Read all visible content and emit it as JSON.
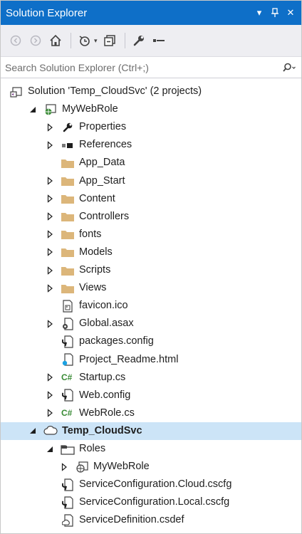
{
  "window": {
    "title": "Solution Explorer",
    "title_buttons": {
      "dropdown": "▾",
      "pin": "ᛘ",
      "close": "✕"
    }
  },
  "search": {
    "placeholder": "Search Solution Explorer (Ctrl+;)"
  },
  "toolbar": {
    "icons": [
      "back-icon",
      "forward-icon",
      "home-icon",
      "history-icon",
      "collapse-all-icon",
      "properties-wrench-icon",
      "preview-dash-icon"
    ]
  },
  "colors": {
    "title_bar": "#0e6fc8",
    "selection": "#cce4f7",
    "folder": "#dcb67a",
    "csharp": "#388a34"
  },
  "tree": [
    {
      "label": "Solution 'Temp_CloudSvc' (2 projects)",
      "icon": "solution-icon",
      "expander": "none",
      "indent": 0
    },
    {
      "label": "MyWebRole",
      "icon": "web-project-icon",
      "expander": "expanded",
      "indent": 1
    },
    {
      "label": "Properties",
      "icon": "wrench-icon",
      "expander": "collapsed",
      "indent": 2
    },
    {
      "label": "References",
      "icon": "references-icon",
      "expander": "collapsed",
      "indent": 2
    },
    {
      "label": "App_Data",
      "icon": "folder-icon",
      "expander": "none",
      "indent": 2
    },
    {
      "label": "App_Start",
      "icon": "folder-icon",
      "expander": "collapsed",
      "indent": 2
    },
    {
      "label": "Content",
      "icon": "folder-icon",
      "expander": "collapsed",
      "indent": 2
    },
    {
      "label": "Controllers",
      "icon": "folder-icon",
      "expander": "collapsed",
      "indent": 2
    },
    {
      "label": "fonts",
      "icon": "folder-icon",
      "expander": "collapsed",
      "indent": 2
    },
    {
      "label": "Models",
      "icon": "folder-icon",
      "expander": "collapsed",
      "indent": 2
    },
    {
      "label": "Scripts",
      "icon": "folder-icon",
      "expander": "collapsed",
      "indent": 2
    },
    {
      "label": "Views",
      "icon": "folder-icon",
      "expander": "collapsed",
      "indent": 2
    },
    {
      "label": "favicon.ico",
      "icon": "image-file-icon",
      "expander": "none",
      "indent": 2
    },
    {
      "label": "Global.asax",
      "icon": "asax-file-icon",
      "expander": "collapsed",
      "indent": 2
    },
    {
      "label": "packages.config",
      "icon": "config-file-icon",
      "expander": "none",
      "indent": 2
    },
    {
      "label": "Project_Readme.html",
      "icon": "html-file-icon",
      "expander": "none",
      "indent": 2
    },
    {
      "label": "Startup.cs",
      "icon": "csharp-file-icon",
      "expander": "collapsed",
      "indent": 2
    },
    {
      "label": "Web.config",
      "icon": "config-file-icon",
      "expander": "collapsed",
      "indent": 2
    },
    {
      "label": "WebRole.cs",
      "icon": "csharp-file-icon",
      "expander": "collapsed",
      "indent": 2
    },
    {
      "label": "Temp_CloudSvc",
      "icon": "cloud-project-icon",
      "expander": "expanded",
      "indent": 1,
      "selected": true,
      "bold": true
    },
    {
      "label": "Roles",
      "icon": "roles-icon",
      "expander": "expanded",
      "indent": 2
    },
    {
      "label": "MyWebRole",
      "icon": "web-role-icon",
      "expander": "collapsed",
      "indent": 3
    },
    {
      "label": "ServiceConfiguration.Cloud.cscfg",
      "icon": "cscfg-file-icon",
      "expander": "none",
      "indent": 2
    },
    {
      "label": "ServiceConfiguration.Local.cscfg",
      "icon": "cscfg-file-icon",
      "expander": "none",
      "indent": 2
    },
    {
      "label": "ServiceDefinition.csdef",
      "icon": "csdef-file-icon",
      "expander": "none",
      "indent": 2
    }
  ]
}
